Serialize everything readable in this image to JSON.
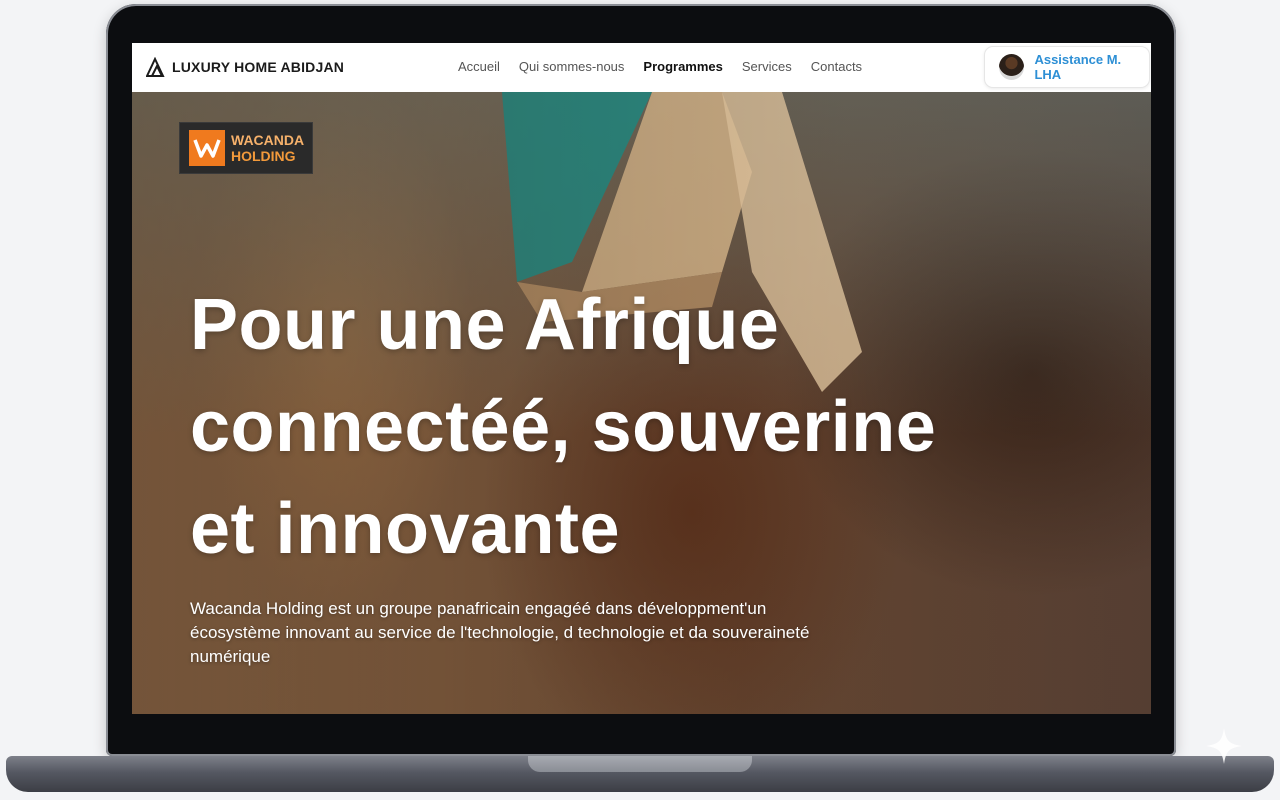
{
  "navbar": {
    "logo_icon": "mountain-logo-icon",
    "logo_text": "LUXURY HOME ABIDJAN",
    "links": [
      "Accueil",
      "Qui sommes-nous",
      "Programmes",
      "Services",
      "Contacts"
    ],
    "active_link": "Programmes",
    "assistance_label": "Assistance M. LHA",
    "assistance_avatar": "person-avatar"
  },
  "hero": {
    "badge_icon": "wacanda-w-logo-icon",
    "badge_line1": "WACANDA",
    "badge_line2": "HOLDING",
    "headline_line1": "Pour une Afrique",
    "headline_line2": "connectéé, souverine",
    "headline_line3": "et innovante",
    "description_line1": "Wacanda Holding est un groupe panafricain engagéé dans développment'un",
    "description_line2": "écosystème innovant  au service de l'technologie, d technologie et da souveraineté",
    "description_line3": "numérique"
  },
  "colors": {
    "accent_link": "#2d8fd5",
    "brand_orange": "#f07a1e",
    "headline": "#ffffff"
  }
}
